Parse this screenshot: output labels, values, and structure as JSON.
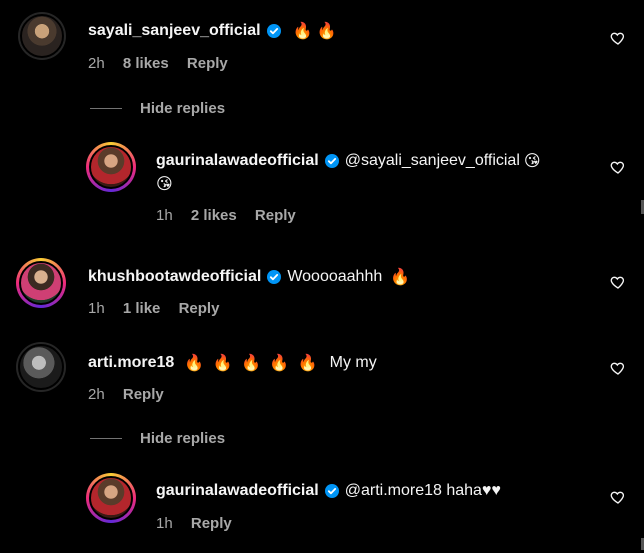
{
  "comments": [
    {
      "username": "sayali_sanjeev_official",
      "verified": true,
      "text": "",
      "emojis": "🔥 🔥",
      "time": "2h",
      "likes": "8 likes",
      "reply_label": "Reply"
    },
    {
      "username": "gaurinalawadeofficial",
      "verified": true,
      "text": "@sayali_sanjeev_official",
      "emojis": "😘",
      "emojis2": "😘",
      "time": "1h",
      "likes": "2 likes",
      "reply_label": "Reply"
    },
    {
      "username": "khushbootawdeofficial",
      "verified": true,
      "text": "Wooooaahhh",
      "emojis": "🔥",
      "time": "1h",
      "likes": "1 like",
      "reply_label": "Reply"
    },
    {
      "username": "arti.more18",
      "verified": false,
      "text": "My my",
      "emojis": "🔥 🔥 🔥 🔥 🔥",
      "time": "2h",
      "likes": "",
      "reply_label": "Reply"
    },
    {
      "username": "gaurinalawadeofficial",
      "verified": true,
      "text": "@arti.more18 haha♥♥",
      "emojis": "",
      "time": "1h",
      "likes": "",
      "reply_label": "Reply"
    }
  ],
  "hide_replies_label": "Hide replies",
  "colors": {
    "verified": "#0095f6",
    "background": "#000000",
    "muted": "#a8a8a8"
  },
  "icons": {
    "like": "heart-outline-icon",
    "verified": "verified-badge-icon"
  }
}
